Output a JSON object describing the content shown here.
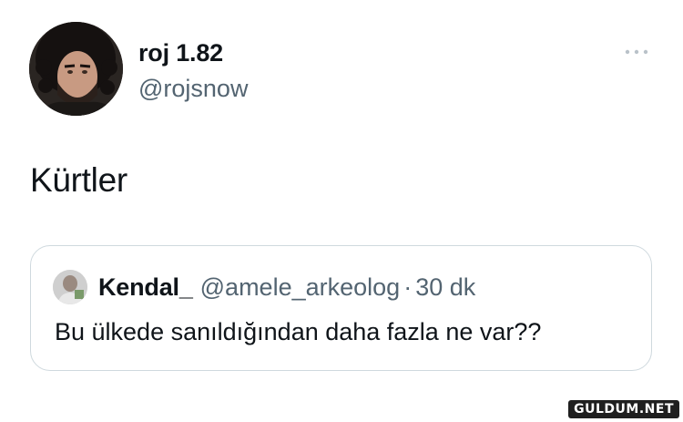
{
  "tweet": {
    "author": {
      "display_name": "roj 1.82",
      "handle": "@rojsnow"
    },
    "text": "Kürtler",
    "more_icon": "more-horizontal-icon"
  },
  "quoted_tweet": {
    "author": {
      "display_name": "Kendal_",
      "handle": "@amele_arkeolog"
    },
    "separator": "·",
    "time": "30 dk",
    "text": "Bu ülkede sanıldığından daha fazla ne var??"
  },
  "watermark": {
    "text": "GULDUM.NET"
  },
  "colors": {
    "text_primary": "#0f1419",
    "text_secondary": "#536471",
    "border": "#cfd9de"
  }
}
